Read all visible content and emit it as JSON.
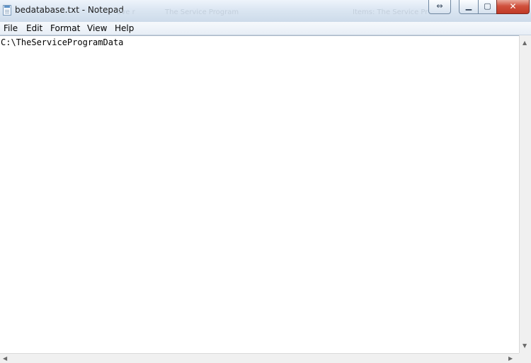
{
  "window": {
    "title": "bedatabase.txt - Notepad",
    "background_titles": [
      "Eve r",
      "The Service Program",
      "Items: The Service Pr"
    ]
  },
  "title_buttons": {
    "snap_icon": "⇔",
    "minimize_icon": "▁",
    "maximize_icon": "▢",
    "close_icon": "✕"
  },
  "menu": [
    "File",
    "Edit",
    "Format",
    "View",
    "Help"
  ],
  "editor": {
    "content": "C:\\TheServiceProgramData"
  },
  "scrollbars": {
    "up": "▲",
    "down": "▼",
    "left": "◀",
    "right": "▶"
  },
  "colors": {
    "titlebar": "#dbe6f2",
    "close_button": "#c13a26",
    "menubar": "#e7eef6",
    "editor_bg": "#ffffff"
  }
}
